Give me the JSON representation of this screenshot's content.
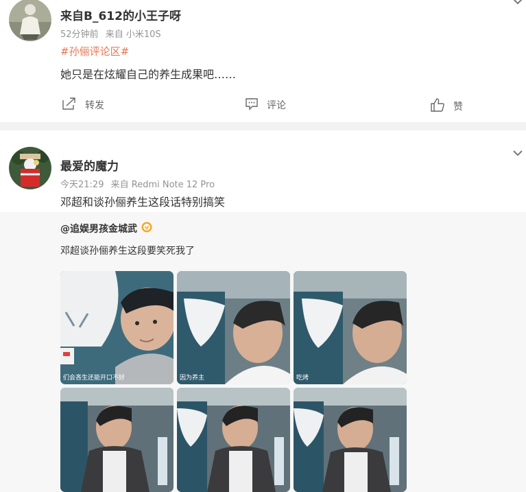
{
  "post1": {
    "username": "来自B_612的小王子呀",
    "time": "52分钟前",
    "source": "来自 小米10S",
    "topic": "#孙俪评论区#",
    "text": "她只是在炫耀自己的养生成果吧……",
    "actions": {
      "repost": "转发",
      "comment": "评论",
      "like": "赞"
    }
  },
  "post2": {
    "username": "最爱的魔力",
    "time": "今天21:29",
    "source": "来自 Redmi Note 12 Pro",
    "text": "邓超和谈孙俪养生这段话特别搞笑",
    "repost": {
      "username": "@追娱男孩金城武",
      "text": "邓超谈孙俪养生这段要笑死我了",
      "image_captions": [
        "们会吝生还能开口不好",
        "因为养主",
        "吃烤",
        "",
        "",
        ""
      ]
    }
  },
  "colors": {
    "topic": "#eb7350",
    "verified_badge": "#f6a623",
    "gap_bar": "#f2f2f2",
    "repost_bg": "#f7f7f7"
  },
  "icons": [
    "chevron-down-icon",
    "repost-icon",
    "comment-icon",
    "like-icon",
    "verified-badge-icon"
  ]
}
